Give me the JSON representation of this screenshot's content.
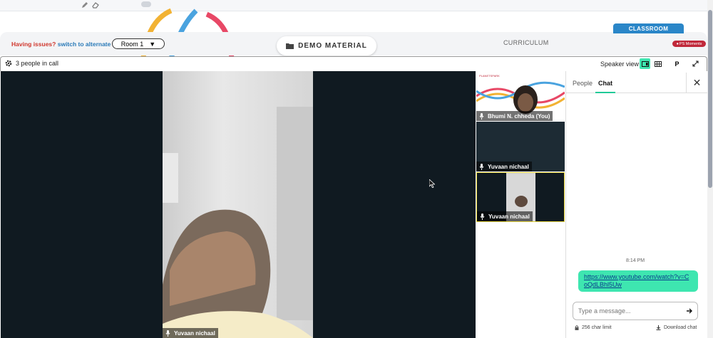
{
  "header": {
    "issues_prefix": "Having issues?",
    "issues_link": "switch to alternate room",
    "room_selected": "Room 1",
    "demo_material": "DEMO MATERIAL",
    "curriculum": "CURRICULUM",
    "classroom": "CLASSROOM",
    "ps_moments": "PS Moments"
  },
  "call": {
    "people_count": "3 people in call",
    "view_label": "Speaker view",
    "presenter_btn": "P"
  },
  "main_speaker": {
    "name": "Yuvaan nichaal"
  },
  "tiles": [
    {
      "name": "Bhumi N. chheda (You)"
    },
    {
      "name": "Yuvaan nichaal"
    },
    {
      "name": "Yuvaan nichaal"
    }
  ],
  "chat": {
    "tab_people": "People",
    "tab_chat": "Chat",
    "timestamp": "8:14 PM",
    "message_link": "https://www.youtube.com/watch?v=CoQdLBhl5Uw",
    "input_placeholder": "Type a message...",
    "char_limit": "256 char limit",
    "download": "Download chat"
  },
  "colors": {
    "accent": "#3ee6b0",
    "classroom_tab": "#2a86c8",
    "ps_badge": "#c0283a",
    "video_bg": "#101a21",
    "active_tile_border": "#e4d33a"
  }
}
